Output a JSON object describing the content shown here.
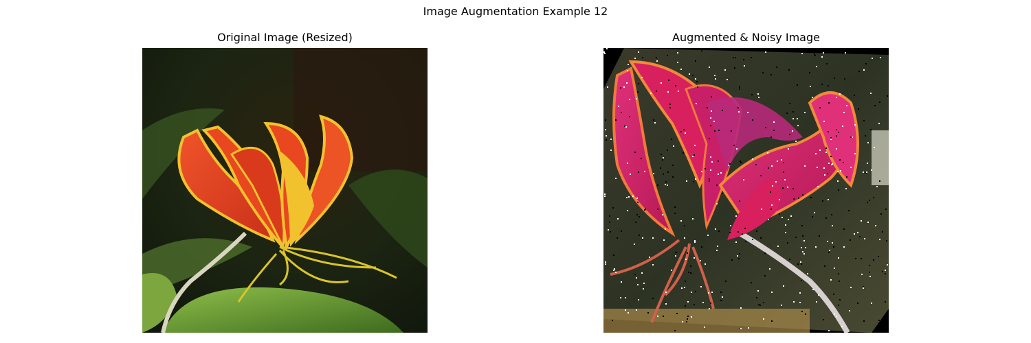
{
  "figure": {
    "suptitle": "Image Augmentation Example 12"
  },
  "panels": [
    {
      "title": "Original Image (Resized)",
      "subject": "orange-red gloriosa lily flower against dark green foliage"
    },
    {
      "title": "Augmented & Noisy Image",
      "subject": "rotated, recoloured magenta gloriosa lily with salt-and-pepper noise"
    }
  ],
  "colors": {
    "background": "#ffffff",
    "petal_original": "#e8471f",
    "petal_edge_original": "#f2c12e",
    "petal_augmented": "#d8205f",
    "petal_edge_augmented": "#f08a3a",
    "foliage_dark": "#1e2a14",
    "foliage_mid": "#3f5a22"
  }
}
